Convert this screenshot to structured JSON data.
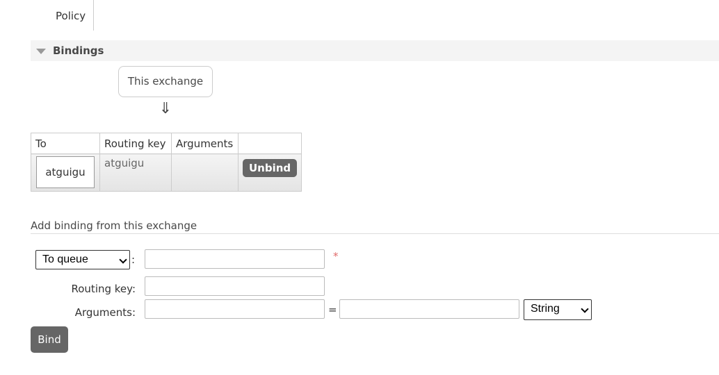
{
  "tabs": {
    "policy": "Policy"
  },
  "bindings_section": {
    "title": "Bindings",
    "source_box": "This exchange",
    "arrow": "⇓",
    "table": {
      "headers": [
        "To",
        "Routing key",
        "Arguments",
        ""
      ],
      "rows": [
        {
          "to": "atguigu",
          "routing_key": "atguigu",
          "arguments": "",
          "action": "Unbind"
        }
      ]
    }
  },
  "add_binding": {
    "title": "Add binding from this exchange",
    "destination_type": "To queue",
    "colon": ":",
    "required_mark": "*",
    "routing_key_label": "Routing key:",
    "arguments_label": "Arguments:",
    "equals": "=",
    "argument_type": "String",
    "bind_label": "Bind",
    "destination_value": "",
    "routing_key_value": "",
    "argument_key_value": "",
    "argument_value": ""
  }
}
